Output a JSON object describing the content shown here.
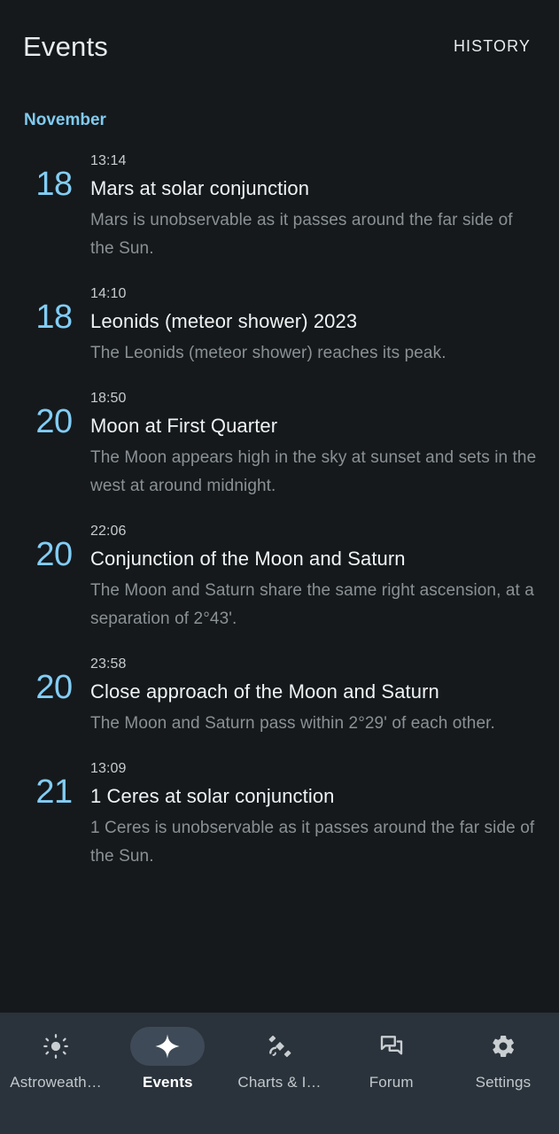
{
  "appbar": {
    "title": "Events",
    "action_label": "HISTORY"
  },
  "colors": {
    "background": "#15191c",
    "nav_background": "#2a323b",
    "accent_blue": "#82cdf5",
    "month_header": "#80cbf0",
    "title_text": "#f0f3f4",
    "description_text": "#8a9194",
    "active_pill": "#3e4a57"
  },
  "content": {
    "month": "November",
    "events": [
      {
        "day": "18",
        "time": "13:14",
        "title": "Mars at solar conjunction",
        "description": "Mars is unobservable as it passes around the far side of the Sun."
      },
      {
        "day": "18",
        "time": "14:10",
        "title": "Leonids (meteor shower) 2023",
        "description": "The Leonids (meteor shower) reaches its peak."
      },
      {
        "day": "20",
        "time": "18:50",
        "title": "Moon at First Quarter",
        "description": "The Moon appears high in the sky at sunset and sets in the west at around midnight."
      },
      {
        "day": "20",
        "time": "22:06",
        "title": "Conjunction of the Moon and Saturn",
        "description": "The Moon and Saturn share the same right ascension, at a separation of 2°43'."
      },
      {
        "day": "20",
        "time": "23:58",
        "title": "Close approach of the Moon and Saturn",
        "description": "The Moon and Saturn pass within 2°29' of each other."
      },
      {
        "day": "21",
        "time": "13:09",
        "title": "1 Ceres at solar conjunction",
        "description": "1 Ceres is unobservable as it passes around the far side of the Sun."
      }
    ]
  },
  "bottom_nav": {
    "items": [
      {
        "label": "Astroweath…",
        "icon": "sun-icon",
        "active": false
      },
      {
        "label": "Events",
        "icon": "star-icon",
        "active": true
      },
      {
        "label": "Charts & I…",
        "icon": "satellite-icon",
        "active": false
      },
      {
        "label": "Forum",
        "icon": "chat-bubbles-icon",
        "active": false
      },
      {
        "label": "Settings",
        "icon": "gear-icon",
        "active": false
      }
    ]
  }
}
